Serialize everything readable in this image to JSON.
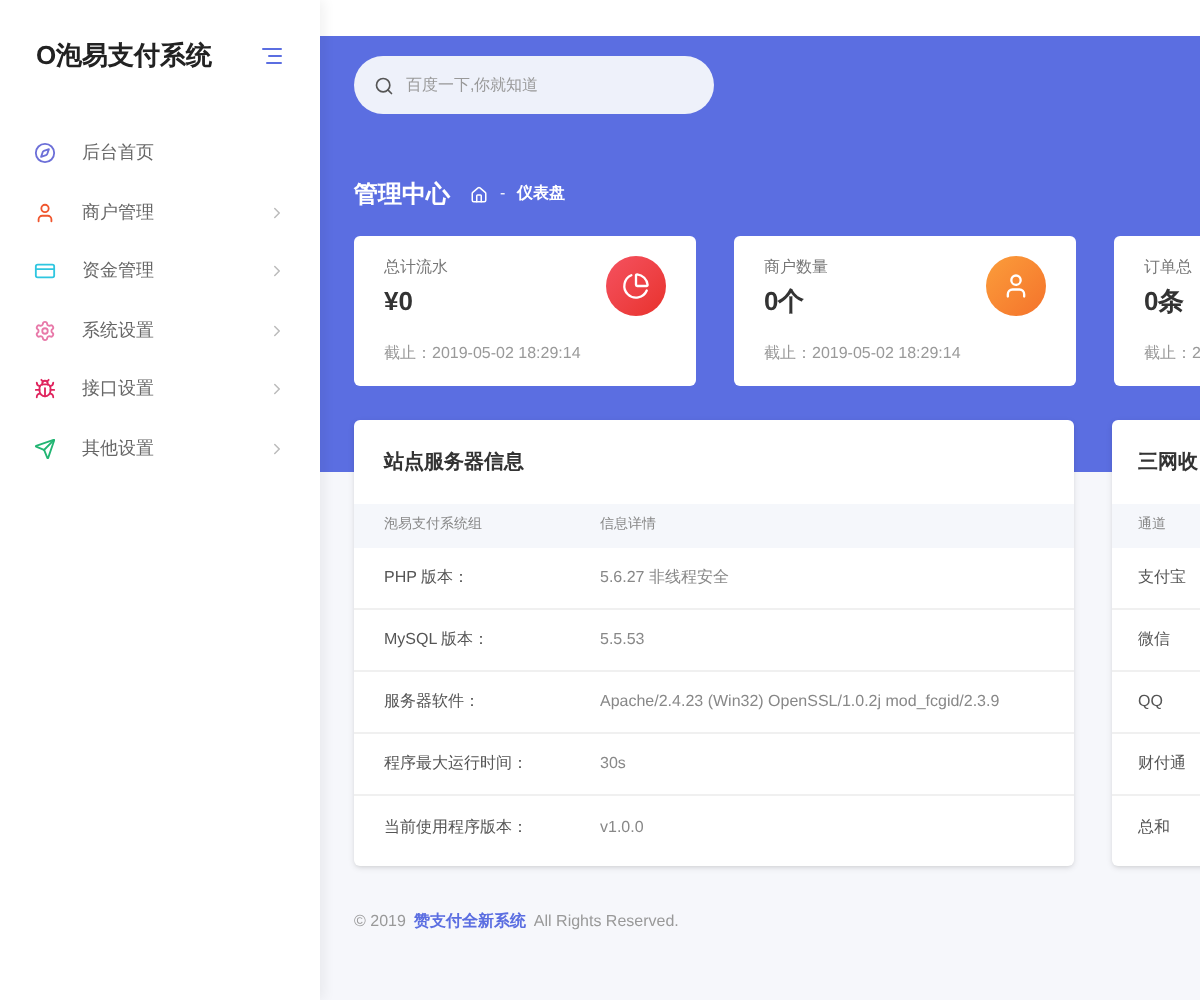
{
  "sidebar": {
    "brand": "O泡易支付系统",
    "items": [
      {
        "label": "后台首页",
        "kind": "compass",
        "color": "#6c6fd8",
        "chevron": false
      },
      {
        "label": "商户管理",
        "kind": "user",
        "color": "#f0562e",
        "chevron": true
      },
      {
        "label": "资金管理",
        "kind": "card",
        "color": "#2fc6e0",
        "chevron": true
      },
      {
        "label": "系统设置",
        "kind": "gear",
        "color": "#e879a9",
        "chevron": true
      },
      {
        "label": "接口设置",
        "kind": "bug",
        "color": "#e0245e",
        "chevron": true
      },
      {
        "label": "其他设置",
        "kind": "send",
        "color": "#22b573",
        "chevron": true
      }
    ]
  },
  "search": {
    "placeholder": "百度一下,你就知道"
  },
  "breadcrumb": {
    "title": "管理中心",
    "separator": "-",
    "current": "仪表盘"
  },
  "stats": [
    {
      "label": "总计流水",
      "value": "¥0",
      "note": "截止：2019-05-02 18:29:14",
      "kind": "pie"
    },
    {
      "label": "商户数量",
      "value": "0个",
      "note": "截止：2019-05-02 18:29:14",
      "kind": "user"
    },
    {
      "label": "订单总",
      "value": "0条",
      "note": "截止：2",
      "kind": "cut"
    }
  ],
  "server_panel": {
    "title": "站点服务器信息",
    "columns": [
      "泡易支付系统组",
      "信息详情"
    ],
    "rows": [
      [
        "PHP 版本：",
        "5.6.27 非线程安全"
      ],
      [
        "MySQL 版本：",
        "5.5.53"
      ],
      [
        "服务器软件：",
        "Apache/2.4.23 (Win32) OpenSSL/1.0.2j mod_fcgid/2.3.9"
      ],
      [
        "程序最大运行时间：",
        "30s"
      ],
      [
        "当前使用程序版本：",
        "v1.0.0"
      ]
    ]
  },
  "side_panel": {
    "title": "三网收",
    "columns": [
      "通道"
    ],
    "rows": [
      "支付宝",
      "微信",
      "QQ",
      "财付通",
      "总和"
    ]
  },
  "footer": {
    "prefix": "© 2019",
    "link": "赞支付全新系统",
    "suffix": "All Rights Reserved."
  }
}
